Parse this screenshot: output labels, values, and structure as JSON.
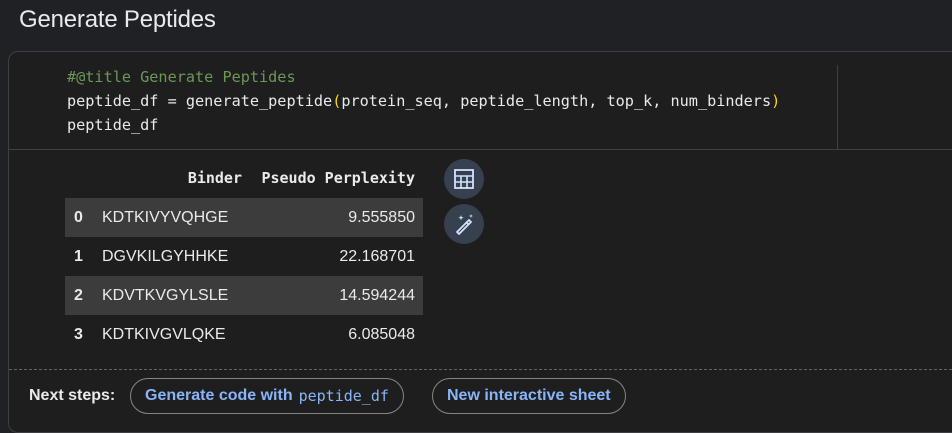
{
  "section": {
    "title": "Generate Peptides"
  },
  "code": {
    "line1": "#@title Generate Peptides",
    "line2_var": "peptide_df",
    "line2_eq": " = ",
    "line2_fn": "generate_peptide",
    "line2_open": "(",
    "line2_args": "protein_seq, peptide_length, top_k, num_binders",
    "line2_close": ")",
    "line3": "peptide_df"
  },
  "dataframe": {
    "columns": [
      "",
      "Binder",
      "Pseudo Perplexity"
    ],
    "rows": [
      {
        "index": "0",
        "binder": "KDTKIVYVQHGE",
        "perplexity": "9.555850"
      },
      {
        "index": "1",
        "binder": "DGVKILGYHHKE",
        "perplexity": "22.168701"
      },
      {
        "index": "2",
        "binder": "KDVTKVGYLSLE",
        "perplexity": "14.594244"
      },
      {
        "index": "3",
        "binder": "KDTKIVGVLQKE",
        "perplexity": "6.085048"
      }
    ]
  },
  "icons": {
    "table": "table-icon",
    "magic": "magic-wand-icon"
  },
  "next_steps": {
    "label": "Next steps:",
    "chip1_text": "Generate code with",
    "chip1_code": "peptide_df",
    "chip2_text": "New interactive sheet"
  },
  "colors": {
    "accent": "#8ab4f8",
    "comment": "#6a9955",
    "bracket": "#ffd700",
    "background": "#202124"
  }
}
